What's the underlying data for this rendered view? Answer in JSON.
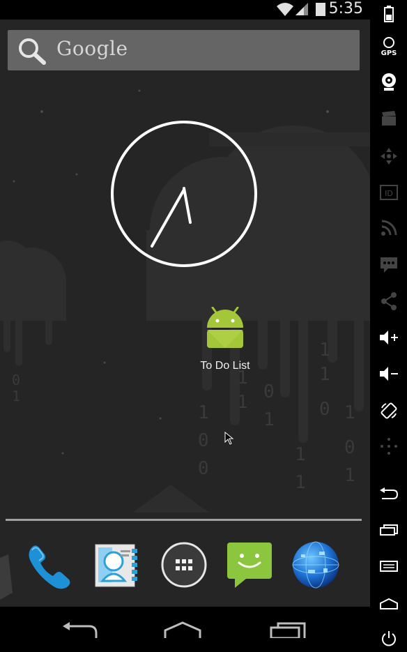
{
  "status_bar": {
    "time": "5:35"
  },
  "search": {
    "label": "Google"
  },
  "apps": [
    {
      "label": "To Do List"
    }
  ],
  "dock": {
    "items": [
      "phone",
      "contacts",
      "all-apps",
      "messaging",
      "browser"
    ]
  },
  "wallpaper": {
    "binary_digits": [
      "1",
      "0",
      "1",
      "0",
      "1",
      "0",
      "0",
      "1",
      "1",
      "0",
      "1",
      "0",
      "1",
      "0",
      "1",
      "1",
      "0",
      "1",
      "1",
      "1",
      "0",
      "0",
      "1",
      "0"
    ]
  },
  "emulator_controls": [
    "gps",
    "camera",
    "video",
    "dpad",
    "id",
    "rss",
    "sms",
    "share",
    "volume-up",
    "volume-down",
    "rotate",
    "dpad-alt",
    "back",
    "recent",
    "menu",
    "home",
    "power"
  ],
  "colors": {
    "android_green": "#a4c639",
    "screen_bg": "#242424",
    "panel_bg": "#000000"
  }
}
